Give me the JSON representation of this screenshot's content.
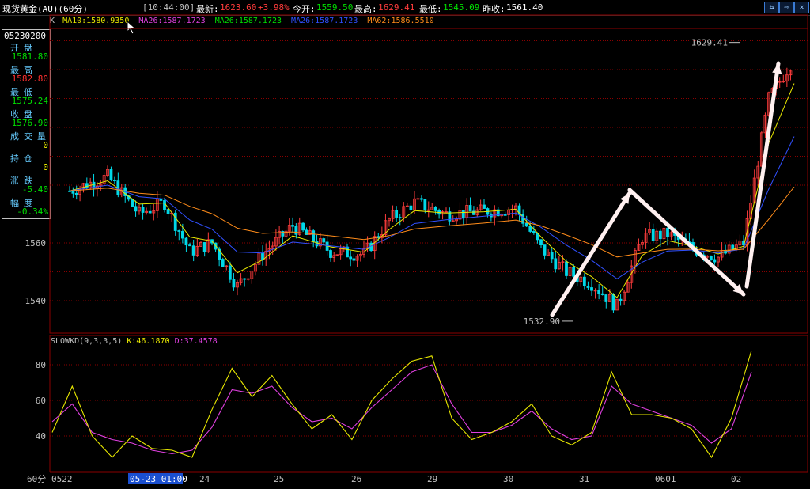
{
  "header": {
    "title": "现货黄金(AU)(60分)",
    "time": "[10:44:00]",
    "latest_label": "最新:",
    "latest_value": "1623.60",
    "change_pct": "+3.98%",
    "open_label": "今开:",
    "open_value": "1559.50",
    "high_label": "最高:",
    "high_value": "1629.41",
    "low_label": "最低:",
    "low_value": "1545.09",
    "prevclose_label": "昨收:",
    "prevclose_value": "1561.40"
  },
  "legend": {
    "prefix": "K",
    "ma10": "MA10:1580.9350",
    "ma26a": "MA26:1587.1723",
    "ma26b": "MA26:1587.1723",
    "ma26c": "MA26:1587.1723",
    "ma62": "MA62:1586.5510"
  },
  "sidebar": {
    "code": "05230200",
    "items": [
      {
        "label": "开盘",
        "value": "1581.80",
        "color": "#00e000"
      },
      {
        "label": "最高",
        "value": "1582.80",
        "color": "#ff3030"
      },
      {
        "label": "最低",
        "value": "1575.24",
        "color": "#00e000"
      },
      {
        "label": "收盘",
        "value": "1576.90",
        "color": "#00e000"
      },
      {
        "label": "成交量",
        "value": "0",
        "color": "#ffff00"
      },
      {
        "label": "持仓",
        "value": "0",
        "color": "#ffff00"
      },
      {
        "label": "涨跌",
        "value": "-5.40",
        "color": "#00e000"
      },
      {
        "label": "幅度",
        "value": "-0.34%",
        "color": "#00e000"
      }
    ]
  },
  "kd": {
    "label": "SLOWKD(9,3,3,5)",
    "k_label": "K:46.1870",
    "d_label": "D:37.4578"
  },
  "bottom": {
    "period": "60分",
    "cursor_date": "05-23 01:00",
    "x_labels": [
      "0522",
      "23",
      "24",
      "25",
      "26",
      "29",
      "30",
      "31",
      "0601",
      "02"
    ]
  },
  "colors": {
    "up": "#ff3c3c",
    "down": "#00d8e8",
    "ma10": "#e8e800",
    "ma26": "#3050ff",
    "ma62": "#ff8c1a",
    "k": "#e8e800",
    "d": "#e040e0",
    "grid": "#8b0000"
  },
  "chart_data": [
    {
      "type": "candlestick",
      "title": "现货黄金(AU)(60分)",
      "price_axis_ticks": [
        1540,
        1560
      ],
      "ylim": [
        1532,
        1633
      ],
      "annotations": [
        {
          "text": "1629.41",
          "x": "02",
          "y": 1629.41
        },
        {
          "text": "1532.90",
          "x": "31",
          "y": 1532.9
        }
      ],
      "x_day_labels": [
        "0522",
        "23",
        "24",
        "25",
        "26",
        "29",
        "30",
        "31",
        "0601",
        "02"
      ],
      "approx_close_path": [
        {
          "x": "0522",
          "y": 1578
        },
        {
          "x": "0522",
          "y": 1583
        },
        {
          "x": "23",
          "y": 1570
        },
        {
          "x": "23",
          "y": 1574
        },
        {
          "x": "23",
          "y": 1557
        },
        {
          "x": "24",
          "y": 1560
        },
        {
          "x": "24",
          "y": 1545
        },
        {
          "x": "24",
          "y": 1556
        },
        {
          "x": "25",
          "y": 1566
        },
        {
          "x": "25",
          "y": 1557
        },
        {
          "x": "26",
          "y": 1556
        },
        {
          "x": "26",
          "y": 1568
        },
        {
          "x": "26",
          "y": 1574
        },
        {
          "x": "29",
          "y": 1570
        },
        {
          "x": "29",
          "y": 1571
        },
        {
          "x": "30",
          "y": 1572
        },
        {
          "x": "30",
          "y": 1558
        },
        {
          "x": "30",
          "y": 1550
        },
        {
          "x": "31",
          "y": 1546
        },
        {
          "x": "31",
          "y": 1538
        },
        {
          "x": "31",
          "y": 1562
        },
        {
          "x": "0601",
          "y": 1563
        },
        {
          "x": "0601",
          "y": 1558
        },
        {
          "x": "0601",
          "y": 1555
        },
        {
          "x": "02",
          "y": 1560
        },
        {
          "x": "02",
          "y": 1610
        },
        {
          "x": "02",
          "y": 1624
        }
      ]
    },
    {
      "type": "line",
      "title": "SLOWKD(9,3,3,5)",
      "y_ticks": [
        40,
        60,
        80
      ],
      "ylim": [
        20,
        95
      ],
      "series": [
        {
          "name": "K",
          "values": [
            42,
            68,
            40,
            28,
            40,
            33,
            32,
            28,
            55,
            78,
            62,
            74,
            58,
            44,
            52,
            38,
            60,
            72,
            82,
            85,
            50,
            38,
            42,
            48,
            58,
            40,
            35,
            42,
            76,
            52,
            52,
            50,
            44,
            28,
            50,
            88
          ]
        },
        {
          "name": "D",
          "values": [
            48,
            58,
            42,
            38,
            36,
            32,
            30,
            32,
            45,
            66,
            64,
            68,
            56,
            48,
            50,
            44,
            56,
            66,
            76,
            80,
            58,
            42,
            42,
            46,
            54,
            44,
            38,
            40,
            68,
            58,
            54,
            50,
            46,
            36,
            44,
            76
          ]
        }
      ]
    }
  ]
}
